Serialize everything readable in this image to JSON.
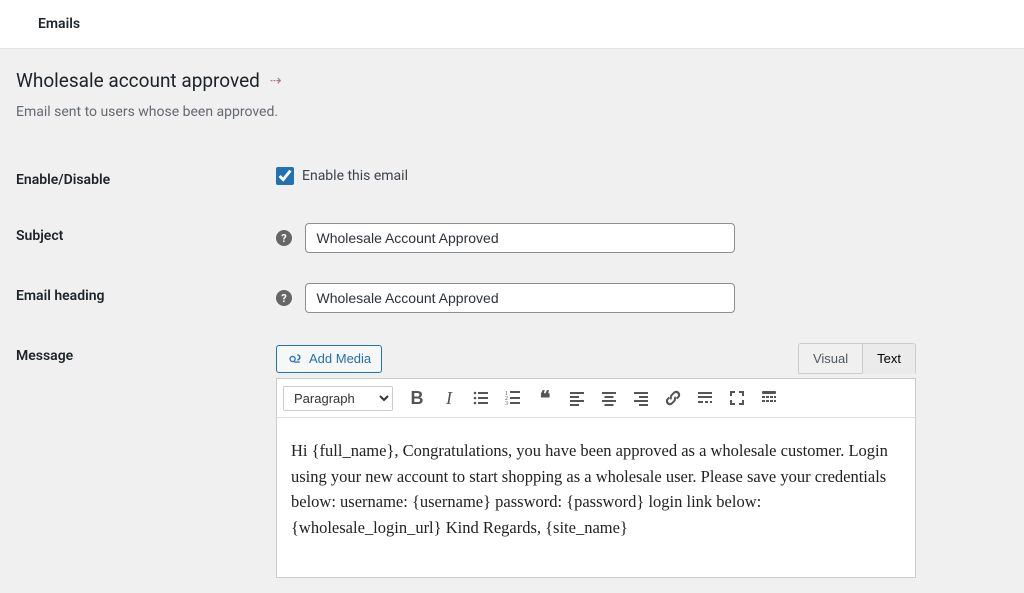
{
  "nav": {
    "title": "Emails"
  },
  "page": {
    "heading": "Wholesale account approved",
    "back_symbol": "⇢",
    "description": "Email sent to users whose been approved."
  },
  "fields": {
    "enable": {
      "label": "Enable/Disable",
      "checkbox_label": "Enable this email",
      "checked": true
    },
    "subject": {
      "label": "Subject",
      "value": "Wholesale Account Approved"
    },
    "heading": {
      "label": "Email heading",
      "value": "Wholesale Account Approved"
    },
    "message": {
      "label": "Message"
    }
  },
  "editor": {
    "add_media": "Add Media",
    "tabs": {
      "visual": "Visual",
      "text": "Text"
    },
    "format_selected": "Paragraph",
    "content": "Hi {full_name}, Congratulations, you have been approved as a wholesale customer. Login using your new account to start shopping as a wholesale user. Please save your credentials below: username: {username} password: {password} login link below: {wholesale_login_url} Kind Regards, {site_name}"
  },
  "help_glyph": "?"
}
